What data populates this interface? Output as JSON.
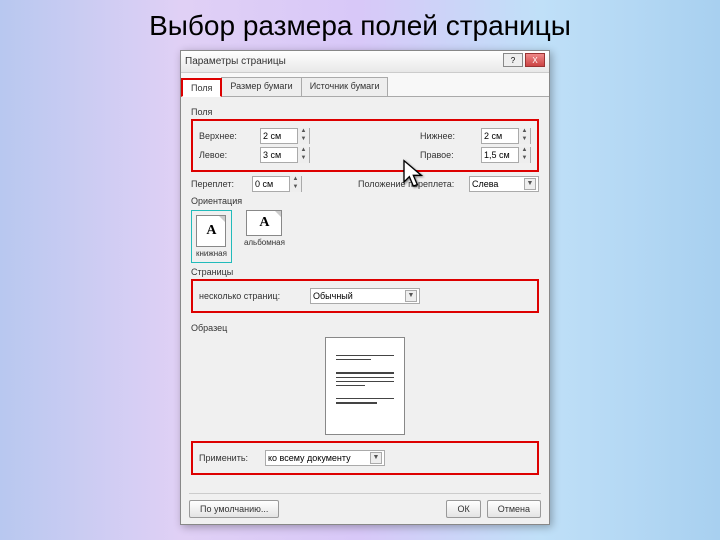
{
  "slide": {
    "title": "Выбор размера полей страницы"
  },
  "dialog": {
    "title": "Параметры страницы",
    "close": "X",
    "help": "?",
    "tabs": {
      "fields": "Поля",
      "paper": "Размер бумаги",
      "source": "Источник бумаги"
    },
    "margins": {
      "label": "Поля",
      "top_label": "Верхнее:",
      "top_value": "2 см",
      "bottom_label": "Нижнее:",
      "bottom_value": "2 см",
      "left_label": "Левое:",
      "left_value": "3 см",
      "right_label": "Правое:",
      "right_value": "1,5 см"
    },
    "gutter": {
      "label": "Переплет:",
      "value": "0 см",
      "pos_label": "Положение переплета:",
      "pos_value": "Слева"
    },
    "orientation": {
      "label": "Ориентация",
      "portrait": "книжная",
      "landscape": "альбомная",
      "letter": "A"
    },
    "pages": {
      "label": "Страницы",
      "multi_label": "несколько страниц:",
      "multi_value": "Обычный"
    },
    "preview": {
      "label": "Образец"
    },
    "apply": {
      "label": "Применить:",
      "value": "ко всему документу"
    },
    "buttons": {
      "default": "По умолчанию...",
      "ok": "ОК",
      "cancel": "Отмена"
    }
  }
}
